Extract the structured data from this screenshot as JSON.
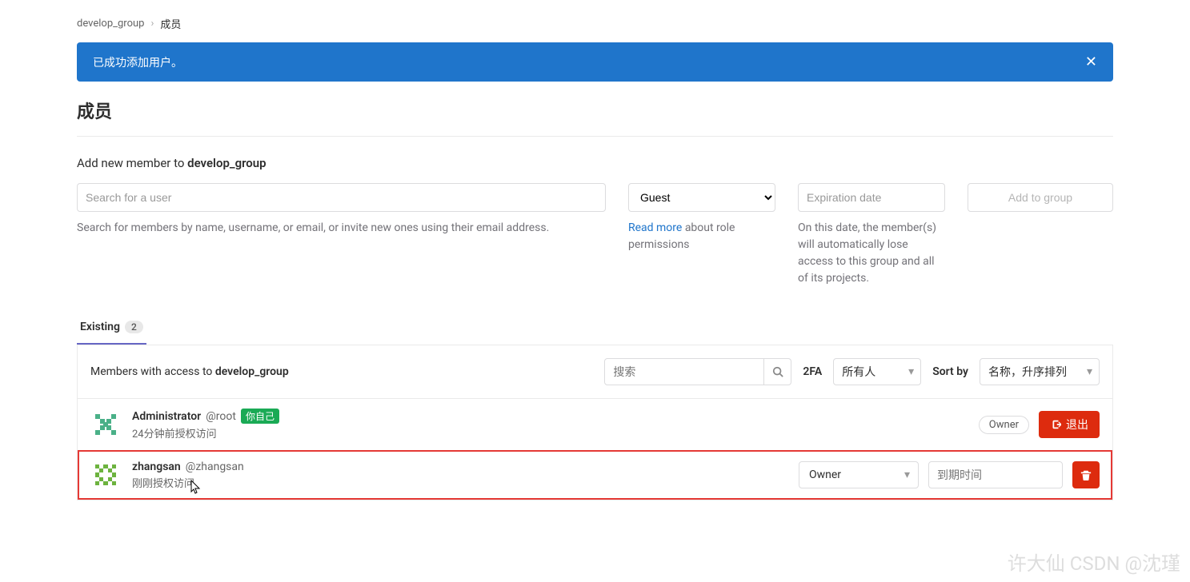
{
  "breadcrumb": {
    "parent": "develop_group",
    "current": "成员"
  },
  "alert": {
    "message": "已成功添加用户。"
  },
  "page": {
    "title": "成员"
  },
  "add_section": {
    "prefix": "Add new member to ",
    "group": "develop_group",
    "search_placeholder": "Search for a user",
    "search_help": "Search for members by name, username, or email, or invite new ones using their email address.",
    "role_selected": "Guest",
    "role_help_link": "Read more",
    "role_help_rest": " about role permissions",
    "date_placeholder": "Expiration date",
    "date_help": "On this date, the member(s) will automatically lose access to this group and all of its projects.",
    "button": "Add to group"
  },
  "tabs": {
    "existing_label": "Existing",
    "existing_count": "2"
  },
  "filter": {
    "prefix": "Members with access to ",
    "group": "develop_group",
    "search_placeholder": "搜索",
    "twofa_label": "2FA",
    "twofa_value": "所有人",
    "sortby_label": "Sort by",
    "sort_value": "名称，升序排列"
  },
  "members": [
    {
      "name": "Administrator",
      "handle": "@root",
      "self_badge": "你自己",
      "sub": "24分钟前授权访问",
      "owner_badge": "Owner",
      "leave_label": "退出"
    },
    {
      "name": "zhangsan",
      "handle": "@zhangsan",
      "sub": "刚刚授权访问",
      "role_value": "Owner",
      "exp_placeholder": "到期时间"
    }
  ],
  "watermark": "许大仙\nCSDN @沈瑾"
}
